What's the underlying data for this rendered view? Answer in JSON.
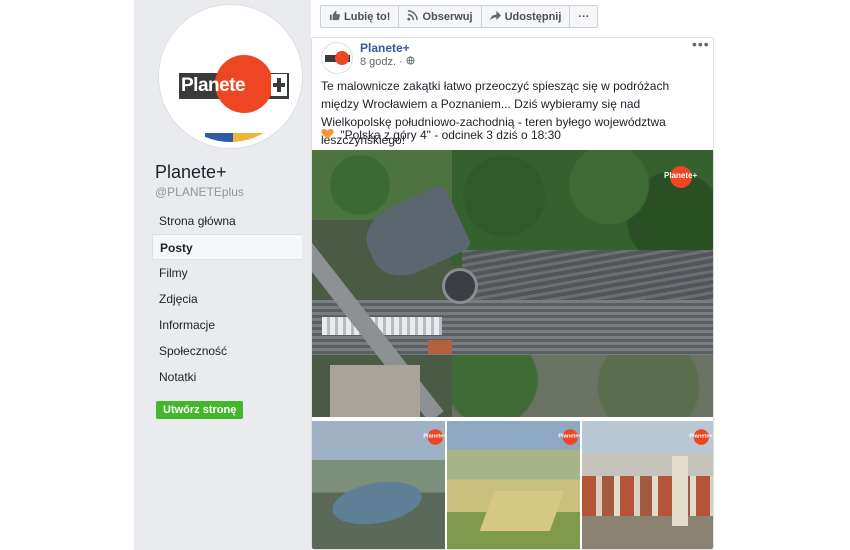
{
  "sidebar": {
    "logo_text": "Planete",
    "page_name": "Planete+",
    "handle": "@PLANETEplus",
    "nav": [
      {
        "label": "Strona główna"
      },
      {
        "label": "Posty"
      },
      {
        "label": "Filmy"
      },
      {
        "label": "Zdjęcia"
      },
      {
        "label": "Informacje"
      },
      {
        "label": "Społeczność"
      },
      {
        "label": "Notatki"
      }
    ],
    "active_index": 1,
    "create_label": "Utwórz stronę"
  },
  "actions": {
    "like": "Lubię to!",
    "follow": "Obserwuj",
    "share": "Udostępnij",
    "more": "···"
  },
  "post": {
    "author": "Planete+",
    "time": "8 godz. · ",
    "more": "•••",
    "text": "Te malownicze zakątki łatwo przeoczyć spiesząc się w podróżach między Wrocławiem a Poznaniem... Dziś wybieramy się nad Wielkopolskę południowo-zachodnią - teren byłego województwa leszczyńskiego!",
    "episode": "\"Polska z góry 4\" - odcinek 3 dziś o 18:30",
    "image_logo": "Planete+"
  },
  "colors": {
    "brand_orange": "#ee4523",
    "link_blue": "#385898",
    "create_green": "#42b72a",
    "sidebar_bg": "#e9ebee"
  },
  "icons": {
    "like": "thumbs-up-icon",
    "follow": "rss-icon",
    "share": "share-arrow-icon",
    "globe": "globe-icon",
    "heart": "orange-heart-icon"
  }
}
